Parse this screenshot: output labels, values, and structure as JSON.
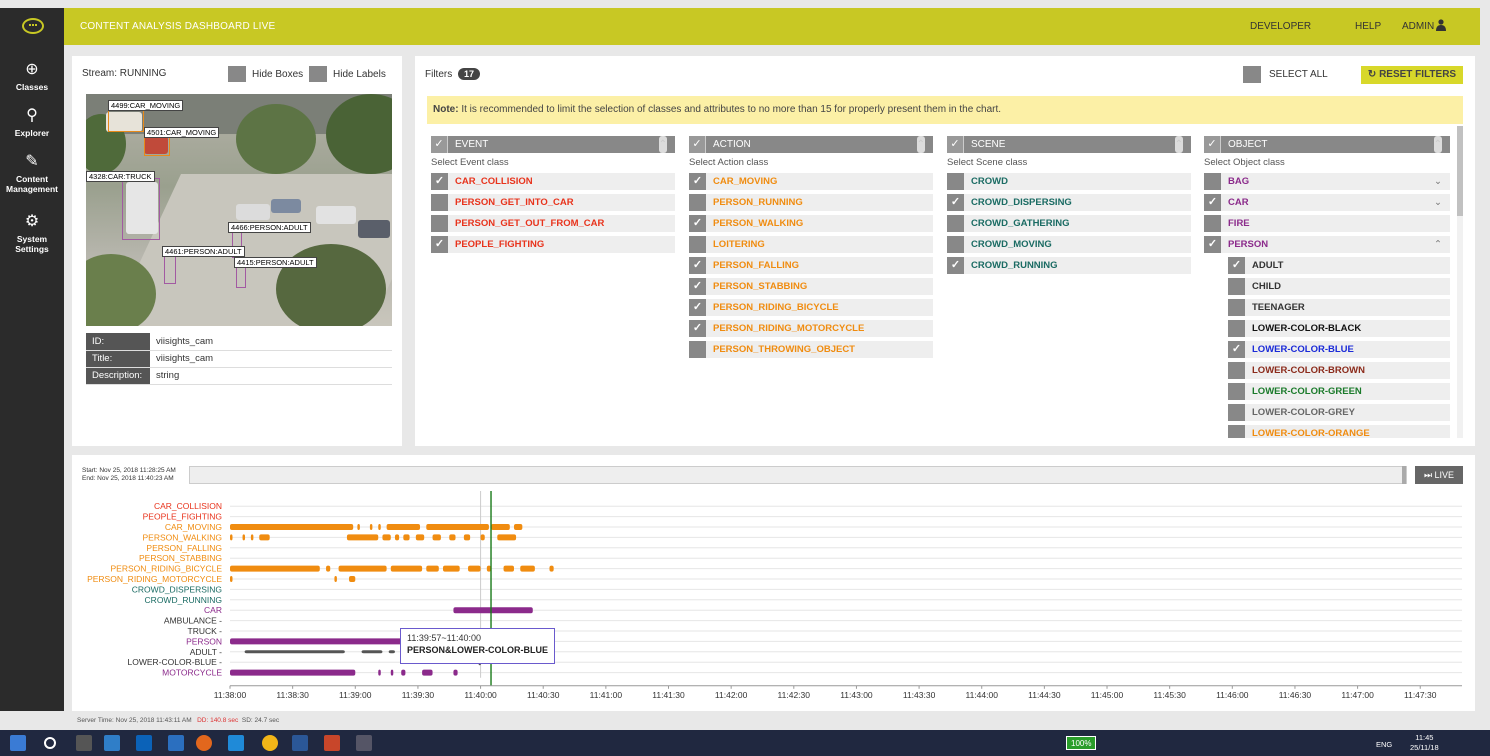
{
  "header": {
    "title": "CONTENT ANALYSIS DASHBOARD LIVE",
    "links": {
      "developer": "DEVELOPER",
      "help": "HELP",
      "admin": "ADMIN"
    }
  },
  "sidebar": {
    "items": [
      {
        "label": "Classes",
        "icon": "crosshair-icon"
      },
      {
        "label": "Explorer",
        "icon": "telescope-icon"
      },
      {
        "label": "Content Management",
        "icon": "edit-icon"
      },
      {
        "label": "System Settings",
        "icon": "gear-icon"
      }
    ]
  },
  "stream": {
    "status": "Stream: RUNNING",
    "hide_boxes": "Hide Boxes",
    "hide_labels": "Hide Labels",
    "detections": [
      "4499:CAR_MOVING",
      "4501:CAR_MOVING",
      "4328:CAR:TRUCK",
      "4466:PERSON:ADULT",
      "4461:PERSON:ADULT",
      "4415:PERSON:ADULT"
    ],
    "meta": [
      {
        "key": "ID:",
        "value": "viisights_cam"
      },
      {
        "key": "Title:",
        "value": "viisights_cam"
      },
      {
        "key": "Description:",
        "value": "string"
      }
    ]
  },
  "filters": {
    "label": "Filters",
    "count": "17",
    "select_all": "SELECT ALL",
    "reset": "RESET FILTERS",
    "note_strong": "Note:",
    "note_text": " It is recommended to limit the selection of classes and attributes to no more than 15 for properly present them in the chart.",
    "columns": [
      {
        "title": "EVENT",
        "subtitle": "Select Event class",
        "color": "#e8331c",
        "items": [
          {
            "label": "CAR_COLLISION",
            "checked": true
          },
          {
            "label": "PERSON_GET_INTO_CAR",
            "checked": false
          },
          {
            "label": "PERSON_GET_OUT_FROM_CAR",
            "checked": false
          },
          {
            "label": "PEOPLE_FIGHTING",
            "checked": true
          }
        ]
      },
      {
        "title": "ACTION",
        "subtitle": "Select Action class",
        "color": "#f08c10",
        "items": [
          {
            "label": "CAR_MOVING",
            "checked": true
          },
          {
            "label": "PERSON_RUNNING",
            "checked": false
          },
          {
            "label": "PERSON_WALKING",
            "checked": true
          },
          {
            "label": "LOITERING",
            "checked": false
          },
          {
            "label": "PERSON_FALLING",
            "checked": true
          },
          {
            "label": "PERSON_STABBING",
            "checked": true
          },
          {
            "label": "PERSON_RIDING_BICYCLE",
            "checked": true
          },
          {
            "label": "PERSON_RIDING_MOTORCYCLE",
            "checked": true
          },
          {
            "label": "PERSON_THROWING_OBJECT",
            "checked": false
          }
        ]
      },
      {
        "title": "SCENE",
        "subtitle": "Select Scene class",
        "color": "#1a6b63",
        "items": [
          {
            "label": "CROWD",
            "checked": false
          },
          {
            "label": "CROWD_DISPERSING",
            "checked": true
          },
          {
            "label": "CROWD_GATHERING",
            "checked": false
          },
          {
            "label": "CROWD_MOVING",
            "checked": false
          },
          {
            "label": "CROWD_RUNNING",
            "checked": true
          }
        ]
      },
      {
        "title": "OBJECT",
        "subtitle": "Select Object class",
        "color": "#8b2a8b",
        "items": [
          {
            "label": "BAG",
            "checked": false,
            "expander": "⌄"
          },
          {
            "label": "CAR",
            "checked": true,
            "expander": "⌄"
          },
          {
            "label": "FIRE",
            "checked": false
          },
          {
            "label": "PERSON",
            "checked": true,
            "expander": "⌃"
          }
        ],
        "attributes": [
          {
            "label": "ADULT",
            "checked": true,
            "color": "#333333"
          },
          {
            "label": "CHILD",
            "checked": false,
            "color": "#333333"
          },
          {
            "label": "TEENAGER",
            "checked": false,
            "color": "#333333"
          },
          {
            "label": "LOWER-COLOR-BLACK",
            "checked": false,
            "color": "#111111"
          },
          {
            "label": "LOWER-COLOR-BLUE",
            "checked": true,
            "color": "#1a2ad8"
          },
          {
            "label": "LOWER-COLOR-BROWN",
            "checked": false,
            "color": "#8b2a1a"
          },
          {
            "label": "LOWER-COLOR-GREEN",
            "checked": false,
            "color": "#1a7a2a"
          },
          {
            "label": "LOWER-COLOR-GREY",
            "checked": false,
            "color": "#666666"
          },
          {
            "label": "LOWER-COLOR-ORANGE",
            "checked": false,
            "color": "#f08c10"
          }
        ]
      }
    ]
  },
  "timeline": {
    "start": "Start: Nov 25, 2018 11:28:25 AM",
    "end": "End: Nov 25, 2018 11:40:23 AM",
    "live": "LIVE",
    "server_time": "Server Time: Nov 25, 2018 11:43:11 AM",
    "dd": "DD: 140.8 sec",
    "sd": "SD: 24.7 sec",
    "tooltip_time": "11:39:57~11:40:00",
    "tooltip_label": "PERSON&LOWER-COLOR-BLUE",
    "rows": [
      {
        "label": "CAR_COLLISION",
        "color": "#e8331c"
      },
      {
        "label": "PEOPLE_FIGHTING",
        "color": "#e8331c"
      },
      {
        "label": "CAR_MOVING",
        "color": "#f08c10"
      },
      {
        "label": "PERSON_WALKING",
        "color": "#f08c10"
      },
      {
        "label": "PERSON_FALLING",
        "color": "#f08c10"
      },
      {
        "label": "PERSON_STABBING",
        "color": "#f08c10"
      },
      {
        "label": "PERSON_RIDING_BICYCLE",
        "color": "#f08c10"
      },
      {
        "label": "PERSON_RIDING_MOTORCYCLE",
        "color": "#f08c10"
      },
      {
        "label": "CROWD_DISPERSING",
        "color": "#1a6b63"
      },
      {
        "label": "CROWD_RUNNING",
        "color": "#1a6b63"
      },
      {
        "label": "CAR",
        "color": "#8b2a8b"
      },
      {
        "label": "AMBULANCE -",
        "color": "#333333"
      },
      {
        "label": "TRUCK -",
        "color": "#333333"
      },
      {
        "label": "PERSON",
        "color": "#8b2a8b"
      },
      {
        "label": "ADULT -",
        "color": "#333333"
      },
      {
        "label": "LOWER-COLOR-BLUE -",
        "color": "#333333"
      },
      {
        "label": "MOTORCYCLE",
        "color": "#8b2a8b"
      }
    ],
    "ticks": [
      "11:38:00",
      "11:38:30",
      "11:39:00",
      "11:39:30",
      "11:40:00",
      "11:40:30",
      "11:41:00",
      "11:41:30",
      "11:42:00",
      "11:42:30",
      "11:43:00",
      "11:43:30",
      "11:44:00",
      "11:44:30",
      "11:45:00",
      "11:45:30",
      "11:46:00",
      "11:46:30",
      "11:47:00",
      "11:47:30"
    ]
  },
  "chart_data": {
    "type": "timeline",
    "x_unit": "time",
    "xlim": [
      "11:38:00",
      "11:47:50"
    ],
    "cursor_time": "11:40:05",
    "hover_marker_time": "11:40:00",
    "segments": [
      {
        "row": "CAR_MOVING",
        "spans": [
          [
            "11:38:00",
            "11:38:59"
          ],
          [
            "11:39:01",
            "11:39:02"
          ],
          [
            "11:39:07",
            "11:39:08"
          ],
          [
            "11:39:11",
            "11:39:12"
          ],
          [
            "11:39:15",
            "11:39:31"
          ],
          [
            "11:39:34",
            "11:40:04"
          ],
          [
            "11:40:05",
            "11:40:14"
          ],
          [
            "11:40:16",
            "11:40:20"
          ]
        ]
      },
      {
        "row": "PERSON_WALKING",
        "spans": [
          [
            "11:38:00",
            "11:38:01"
          ],
          [
            "11:38:06",
            "11:38:07"
          ],
          [
            "11:38:10",
            "11:38:11"
          ],
          [
            "11:38:14",
            "11:38:19"
          ],
          [
            "11:38:56",
            "11:39:11"
          ],
          [
            "11:39:13",
            "11:39:17"
          ],
          [
            "11:39:19",
            "11:39:21"
          ],
          [
            "11:39:23",
            "11:39:26"
          ],
          [
            "11:39:29",
            "11:39:33"
          ],
          [
            "11:39:37",
            "11:39:41"
          ],
          [
            "11:39:45",
            "11:39:48"
          ],
          [
            "11:39:52",
            "11:39:55"
          ],
          [
            "11:40:00",
            "11:40:02"
          ],
          [
            "11:40:08",
            "11:40:17"
          ]
        ]
      },
      {
        "row": "PERSON_RIDING_BICYCLE",
        "spans": [
          [
            "11:38:00",
            "11:38:43"
          ],
          [
            "11:38:46",
            "11:38:48"
          ],
          [
            "11:38:52",
            "11:39:15"
          ],
          [
            "11:39:17",
            "11:39:32"
          ],
          [
            "11:39:34",
            "11:39:40"
          ],
          [
            "11:39:42",
            "11:39:50"
          ],
          [
            "11:39:54",
            "11:40:00"
          ],
          [
            "11:40:03",
            "11:40:05"
          ],
          [
            "11:40:11",
            "11:40:16"
          ],
          [
            "11:40:19",
            "11:40:26"
          ],
          [
            "11:40:33",
            "11:40:35"
          ]
        ]
      },
      {
        "row": "PERSON_RIDING_MOTORCYCLE",
        "spans": [
          [
            "11:38:00",
            "11:38:01"
          ],
          [
            "11:38:50",
            "11:38:51"
          ],
          [
            "11:38:57",
            "11:39:00"
          ]
        ]
      },
      {
        "row": "CAR",
        "spans": [
          [
            "11:39:47",
            "11:40:25"
          ]
        ]
      },
      {
        "row": "PERSON",
        "spans": [
          [
            "11:38:00",
            "11:40:25"
          ]
        ]
      },
      {
        "row": "ADULT -",
        "spans": [
          [
            "11:38:07",
            "11:38:55"
          ],
          [
            "11:39:03",
            "11:39:13"
          ],
          [
            "11:39:16",
            "11:39:19"
          ],
          [
            "11:39:24",
            "11:39:45"
          ]
        ]
      },
      {
        "row": "LOWER-COLOR-BLUE -",
        "spans": [
          [
            "11:39:59",
            "11:40:00"
          ]
        ]
      },
      {
        "row": "MOTORCYCLE",
        "spans": [
          [
            "11:38:00",
            "11:39:00"
          ],
          [
            "11:39:11",
            "11:39:12"
          ],
          [
            "11:39:17",
            "11:39:18"
          ],
          [
            "11:39:22",
            "11:39:24"
          ],
          [
            "11:39:32",
            "11:39:37"
          ],
          [
            "11:39:47",
            "11:39:49"
          ]
        ]
      }
    ]
  }
}
